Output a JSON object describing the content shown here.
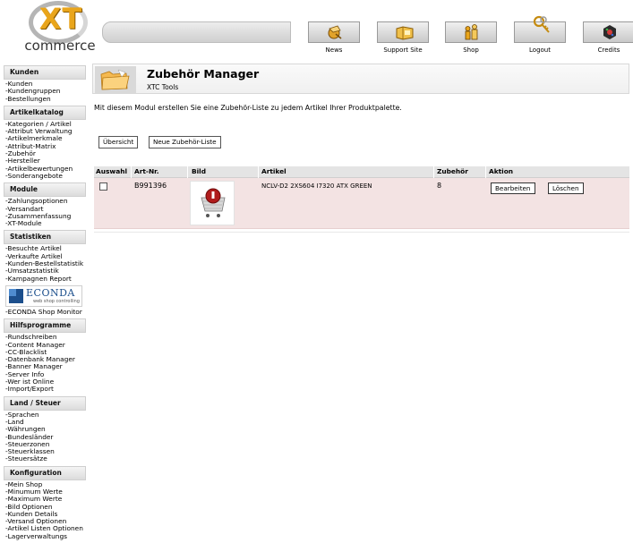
{
  "logo": {
    "mark": "XT",
    "word": "commerce"
  },
  "header_nav": [
    {
      "label": "News",
      "icon": "news-icon"
    },
    {
      "label": "Support Site",
      "icon": "support-icon"
    },
    {
      "label": "Shop",
      "icon": "shop-icon"
    },
    {
      "label": "Logout",
      "icon": "logout-icon"
    },
    {
      "label": "Credits",
      "icon": "credits-icon"
    }
  ],
  "sidebar": {
    "kunden": {
      "title": "Kunden",
      "items": [
        "-Kunden",
        "-Kundengruppen",
        "-Bestellungen"
      ]
    },
    "artikelkatalog": {
      "title": "Artikelkatalog",
      "items": [
        "-Kategorien / Artikel",
        "-Attribut Verwaltung",
        "-Artikelmerkmale",
        "-Attribut-Matrix",
        "-Zubehör",
        "-Hersteller",
        "-Artikelbewertungen",
        "-Sonderangebote"
      ]
    },
    "module": {
      "title": "Module",
      "items": [
        "-Zahlungsoptionen",
        "-Versandart",
        "-Zusammenfassung",
        "-XT-Module"
      ]
    },
    "statistiken": {
      "title": "Statistiken",
      "items": [
        "-Besuchte Artikel",
        "-Verkaufte Artikel",
        "-Kunden-Bestellstatistik",
        "-Umsatzstatistik",
        "-Kampagnen Report"
      ]
    },
    "econda": {
      "name": "ECONDA",
      "tagline": "web shop controlling",
      "link": "-ECONDA Shop Monitor"
    },
    "hilfsprogramme": {
      "title": "Hilfsprogramme",
      "items": [
        "-Rundschreiben",
        "-Content Manager",
        "-CC-Blacklist",
        "-Datenbank Manager",
        "-Banner Manager",
        "-Server Info",
        "-Wer ist Online",
        "-Import/Export"
      ]
    },
    "land_steuer": {
      "title": "Land / Steuer",
      "items": [
        "-Sprachen",
        "-Land",
        "-Währungen",
        "-Bundesländer",
        "-Steuerzonen",
        "-Steuerklassen",
        "-Steuersätze"
      ]
    },
    "konfiguration": {
      "title": "Konfiguration",
      "items": [
        "-Mein Shop",
        "-Minumum Werte",
        "-Maximum Werte",
        "-Bild Optionen",
        "-Kunden Details",
        "-Versand Optionen",
        "-Artikel Listen Optionen",
        "-Lagerverwaltungs"
      ]
    }
  },
  "main": {
    "title": "Zubehör Manager",
    "subtitle": "XTC Tools",
    "intro": "Mit diesem Modul erstellen Sie eine Zubehör-Liste zu jedem Artikel Ihrer Produktpalette.",
    "overview_button": "Übersicht",
    "new_list_button": "Neue Zubehör-Liste",
    "table": {
      "headers": [
        "Auswahl",
        "Art-Nr.",
        "Bild",
        "Artikel",
        "Zubehör",
        "Aktion"
      ],
      "rows": [
        {
          "art_nr": "B991396",
          "artikel": "NCLV-D2 2XS604 I7320 ATX GREEN",
          "zubehoer": "8",
          "edit": "Bearbeiten",
          "delete": "Löschen"
        }
      ]
    }
  }
}
